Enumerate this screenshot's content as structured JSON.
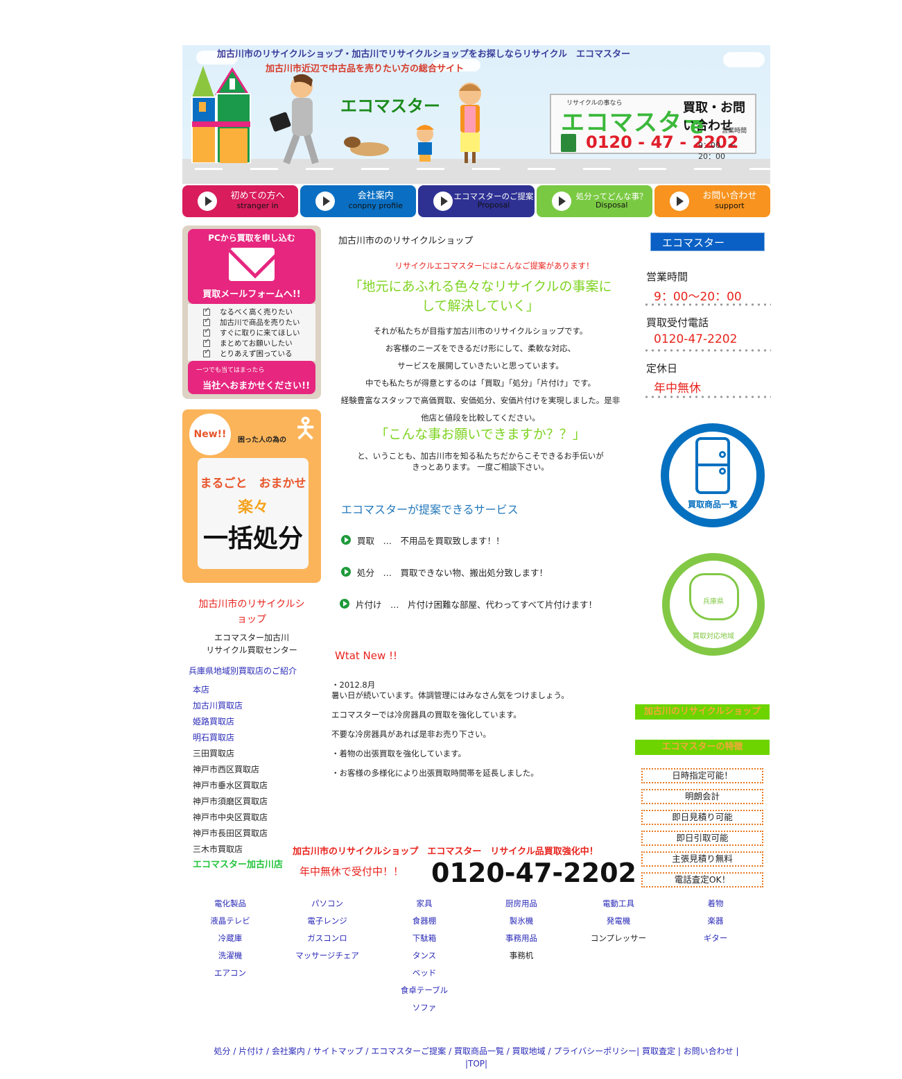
{
  "header": {
    "title": "加古川市のリサイクルショップ・加古川でリサイクルショップをお探しならリサイクル　エコマスター",
    "subtitle": "加古川市近辺で中古品を売りたい方の総合サイト",
    "brand": "エコマスター",
    "phone_box": {
      "tagline": "リサイクルの事なら",
      "brand": "エコマスター",
      "inquiry": "買取・お問い合わせ",
      "logo": "e",
      "hours_label": "営業時間",
      "hours": "9：00　～　20：00",
      "tel": "0120 - 47 - 2202"
    }
  },
  "nav": [
    {
      "jp": "初めての方へ",
      "en": "stranger in",
      "color": "#d81c5c"
    },
    {
      "jp": "会社案内",
      "en": "conpny profile",
      "color": "#0a6fc2"
    },
    {
      "jp": "エコマスターのご提案",
      "en": "Proposal",
      "color": "#2e3192"
    },
    {
      "jp": "処分ってどんな事？",
      "en": "Disposal",
      "color": "#7ac943"
    },
    {
      "jp": "お問い合わせ",
      "en": "support",
      "color": "#f7931e"
    }
  ],
  "mail_banner": {
    "top": "PCから買取を申し込む",
    "cta": "買取メールフォームへ!!",
    "checklist": [
      "なるべく高く売りたい",
      "加古川で商品を売りたい",
      "すぐに取りに来てほしい",
      "まとめてお願いしたい",
      "とりあえず困っている"
    ],
    "bottom_small": "一つでも当てはまったら",
    "bottom_big": "当社へおまかせください!!"
  },
  "disposal_banner": {
    "badge": "New!!",
    "label": "困った人の為の",
    "line1": "まるごと　おまかせ",
    "line2": "楽々",
    "line3": "一括処分"
  },
  "left": {
    "shop_title": "加古川市のリサイクルショップ",
    "shop_name1": "エコマスター加古川",
    "shop_name2": "リサイクル買取センター",
    "area_title": "兵庫県地域別買取店のご紹介",
    "stores": [
      {
        "name": "本店",
        "style": "link"
      },
      {
        "name": "加古川買取店",
        "style": "link"
      },
      {
        "name": "姫路買取店",
        "style": "link"
      },
      {
        "name": "明石買取店",
        "style": "link"
      },
      {
        "name": "三田買取店",
        "style": "plain"
      },
      {
        "name": "神戸市西区買取店",
        "style": "plain"
      },
      {
        "name": "神戸市垂水区買取店",
        "style": "plain"
      },
      {
        "name": "神戸市須磨区買取店",
        "style": "plain"
      },
      {
        "name": "神戸市中央区買取店",
        "style": "plain"
      },
      {
        "name": "神戸市長田区買取店",
        "style": "plain"
      },
      {
        "name": "三木市買取店",
        "style": "plain"
      },
      {
        "name": "エコマスター加古川店",
        "style": "green"
      }
    ]
  },
  "main": {
    "heading": "加古川市ののリサイクルショップ",
    "red_line": "リサイクルエコマスターにはこんなご提案があります！",
    "quote1": "「地元にあふれる色々なリサイクルの事案にして解決していく」",
    "body": [
      "それが私たちが目指す加古川市のリサイクルショップです。",
      "お客様のニーズをできるだけ形にして、柔軟な対応、",
      "サービスを展開していきたいと思っています。",
      "中でも私たちが得意とするのは「買取」「処分」「片付け」です。",
      "経験豊富なスタッフで高価買取、安価処分、安価片付けを実現しました。是非他店と値段を比較してください。"
    ],
    "quote2": "「こんな事お願いできますか？？」",
    "body2": [
      "と、いうことも、加古川市を知る私たちだからこそできるお手伝いが",
      "きっとあります。 一度ご相談下さい。"
    ],
    "services_title": "エコマスターが提案できるサービス",
    "services": [
      "買取　…　不用品を買取致します！！",
      "処分　…　買取できない物、搬出処分致します！",
      "片付け　…　片付け困難な部屋、代わってすべて片付けます！"
    ],
    "news_title": "Wtat New !!",
    "news_date": "・2012.8月",
    "news": [
      "暑い日が続いています。体調管理にはみなさん気をつけましょう。",
      "エコマスターでは冷房器具の買取を強化しています。",
      "不要な冷房器具があれば是非お売り下さい。",
      "・着物の出張買取を強化しています。",
      "・お客様の多様化により出張買取時間帯を延長しました。"
    ],
    "promo1": "加古川市のリサイクルショップ　エコマスター　リサイクル品買取強化中！",
    "promo2": "年中無休で受付中！！",
    "promo_tel": "0120-47-2202"
  },
  "right": {
    "brand": "エコマスター",
    "hours_label": "営業時間",
    "hours": "9：00～20：00",
    "tel_label": "買取受付電話",
    "tel": "0120-47-2202",
    "holiday_label": "定休日",
    "holiday": "年中無休",
    "items_label": "買取商品一覧",
    "area_pref": "兵庫県",
    "area_label": "買取対応地域",
    "green1": "加古川のリサイクルショップ",
    "green2": "エコマスターの特徴",
    "features": [
      "日時指定可能！",
      "明朗会計",
      "即日見積り可能",
      "即日引取可能",
      "主張見積り無料",
      "電話査定OK！"
    ]
  },
  "categories": [
    [
      {
        "t": "電化製品",
        "s": "link"
      },
      {
        "t": "液晶テレビ",
        "s": "link"
      },
      {
        "t": "冷蔵庫",
        "s": "link"
      },
      {
        "t": "洗濯機",
        "s": "link"
      },
      {
        "t": "エアコン",
        "s": "link"
      }
    ],
    [
      {
        "t": "パソコン",
        "s": "link"
      },
      {
        "t": "電子レンジ",
        "s": "link"
      },
      {
        "t": "ガスコンロ",
        "s": "link"
      },
      {
        "t": "マッサージチェア",
        "s": "link"
      }
    ],
    [
      {
        "t": "家具",
        "s": "link"
      },
      {
        "t": "食器棚",
        "s": "link"
      },
      {
        "t": "下駄箱",
        "s": "link"
      },
      {
        "t": "タンス",
        "s": "link"
      },
      {
        "t": "ベッド",
        "s": "link"
      },
      {
        "t": "食卓テーブル",
        "s": "link"
      },
      {
        "t": "ソファ",
        "s": "link"
      }
    ],
    [
      {
        "t": "厨房用品",
        "s": "link"
      },
      {
        "t": "製氷機",
        "s": "link"
      },
      {
        "t": "事務用品",
        "s": "link"
      },
      {
        "t": "事務机",
        "s": "plain"
      }
    ],
    [
      {
        "t": "電動工具",
        "s": "link"
      },
      {
        "t": "発電機",
        "s": "link"
      },
      {
        "t": "コンプレッサー",
        "s": "plain"
      }
    ],
    [
      {
        "t": "着物",
        "s": "link"
      },
      {
        "t": "楽器",
        "s": "link"
      },
      {
        "t": "ギター",
        "s": "link"
      }
    ]
  ],
  "footer": {
    "links": [
      "処分",
      "片付け",
      "会社案内",
      "サイトマップ",
      "エコマスターご提案",
      "買取商品一覧",
      "買取地域",
      "プライバシーポリシー",
      "買取査定",
      "お問い合わせ"
    ],
    "separators": [
      " / ",
      " / ",
      " / ",
      " / ",
      " / ",
      " / ",
      " / ",
      "| ",
      " | ",
      " |"
    ],
    "top": "TOP"
  }
}
